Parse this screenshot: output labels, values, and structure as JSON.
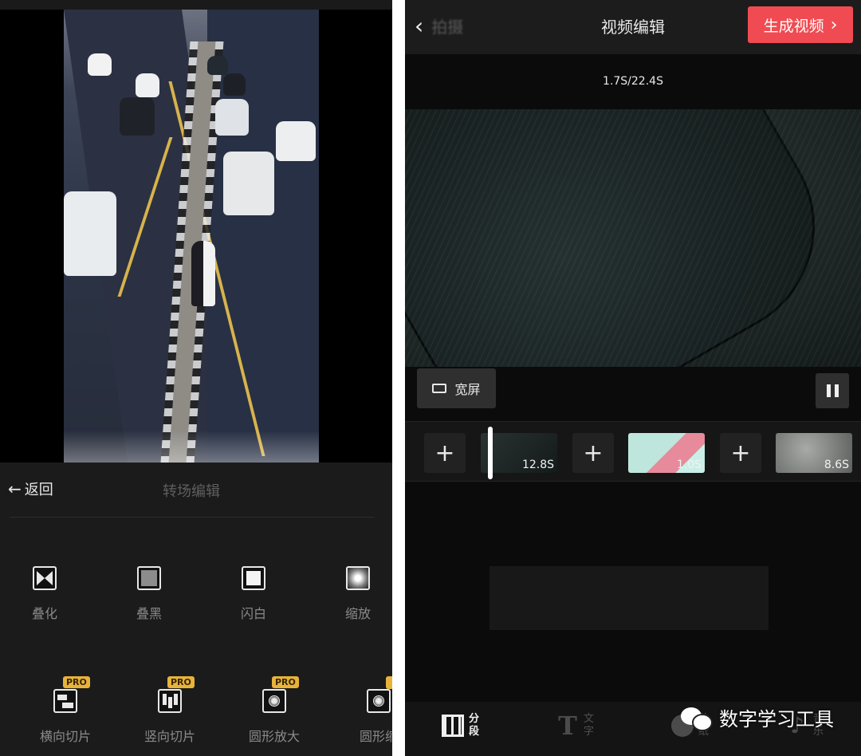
{
  "left": {
    "back_label": "返回",
    "title": "转场编辑",
    "transitions": [
      {
        "label": "叠化",
        "icon": "crossfade-icon",
        "pro": false
      },
      {
        "label": "叠黑",
        "icon": "fade-black-icon",
        "pro": false
      },
      {
        "label": "闪白",
        "icon": "flash-white-icon",
        "pro": false
      },
      {
        "label": "缩放",
        "icon": "zoom-icon",
        "pro": false
      },
      {
        "label": "横向切片",
        "icon": "horizontal-slice-icon",
        "pro": true
      },
      {
        "label": "竖向切片",
        "icon": "vertical-slice-icon",
        "pro": true
      },
      {
        "label": "圆形放大",
        "icon": "circle-zoom-in-icon",
        "pro": true
      },
      {
        "label": "圆形缩",
        "icon": "circle-zoom-out-icon",
        "pro": true
      }
    ],
    "pro_badge": "PRO"
  },
  "right": {
    "back_label": "拍摄",
    "title": "视频编辑",
    "generate_label": "生成视频",
    "time_display": "1.7S/22.4S",
    "widescreen_label": "宽屏",
    "clips": [
      {
        "duration": "12.8S"
      },
      {
        "duration": "1.0S"
      },
      {
        "duration": "8.6S"
      }
    ],
    "tabs": [
      {
        "label": "分段",
        "active": true
      },
      {
        "label": "文字",
        "active": false
      },
      {
        "label": "贴纸",
        "active": false
      },
      {
        "label": "音乐",
        "active": false
      }
    ]
  },
  "watermark": "数字学习工具",
  "colors": {
    "accent_red": "#f04b52",
    "pro_gold": "#e7b33b"
  }
}
